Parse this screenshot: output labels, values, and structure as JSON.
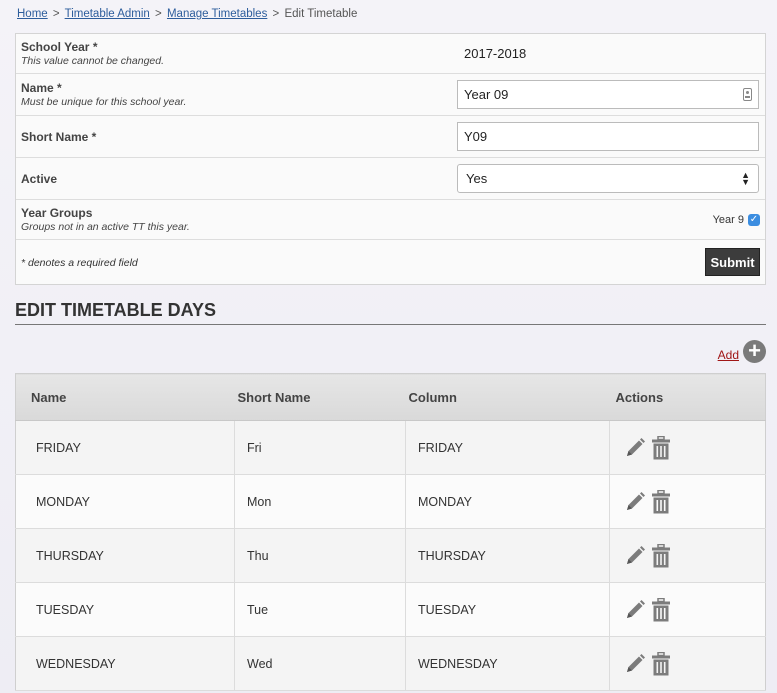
{
  "breadcrumb": {
    "home": "Home",
    "sep": ">",
    "timetable_admin": "Timetable Admin",
    "manage_timetables": "Manage Timetables",
    "current": "Edit Timetable"
  },
  "form": {
    "school_year": {
      "label": "School Year *",
      "description": "This value cannot be changed.",
      "value": "2017-2018"
    },
    "name": {
      "label": "Name *",
      "description": "Must be unique for this school year.",
      "value": "Year 09"
    },
    "short_name": {
      "label": "Short Name *",
      "value": "Y09"
    },
    "active": {
      "label": "Active",
      "value": "Yes"
    },
    "year_groups": {
      "label": "Year Groups",
      "description": "Groups not in an active TT this year.",
      "option": "Year 9",
      "checked": true
    },
    "required_note": "* denotes a required field",
    "submit_label": "Submit"
  },
  "days_section": {
    "title": "Edit Timetable Days",
    "add_label": "Add",
    "add_icon": "plus-circle-icon",
    "columns": [
      "Name",
      "Short Name",
      "Column",
      "Actions"
    ],
    "rows": [
      {
        "name": "FRIDAY",
        "short": "Fri",
        "column": "FRIDAY"
      },
      {
        "name": "MONDAY",
        "short": "Mon",
        "column": "MONDAY"
      },
      {
        "name": "THURSDAY",
        "short": "Thu",
        "column": "THURSDAY"
      },
      {
        "name": "TUESDAY",
        "short": "Tue",
        "column": "TUESDAY"
      },
      {
        "name": "WEDNESDAY",
        "short": "Wed",
        "column": "WEDNESDAY"
      }
    ]
  },
  "colors": {
    "link": "#2d5d9c",
    "add_link": "#a01616",
    "submit_bg": "#3c3c3c",
    "checkbox": "#3b8de0"
  }
}
